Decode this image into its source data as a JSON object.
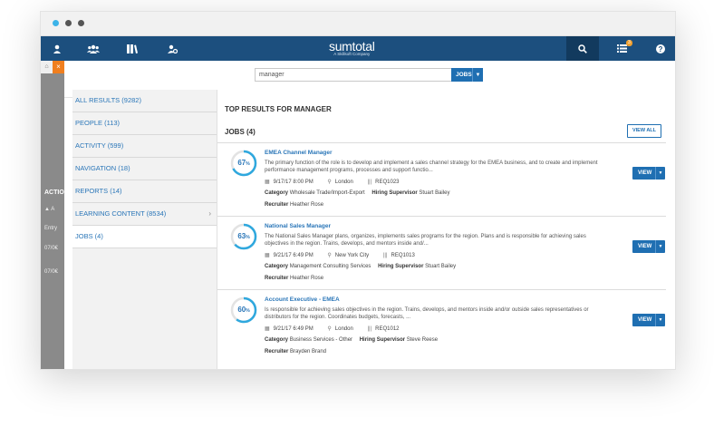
{
  "colors": {
    "navbar": "#1c4f7e",
    "accent": "#2a76b8",
    "button": "#1f6fb2",
    "close": "#f07f1f",
    "badge": "#f0a030"
  },
  "window": {
    "dots": [
      "#3cb3e8",
      "#555555",
      "#555555"
    ]
  },
  "navbar": {
    "icons": [
      "user-icon",
      "users-icon",
      "books-icon",
      "user-settings-icon"
    ],
    "logo_name": "sumtotal",
    "logo_sub": "A Skillsoft Company",
    "notifications_count": "3"
  },
  "left_rail": {
    "texts": [
      "ACTIO",
      "▲ A",
      "Entry",
      "07/0€",
      "07/0€"
    ]
  },
  "search": {
    "value": "manager",
    "scope": "JOBS"
  },
  "sidebar": {
    "items": [
      {
        "label": "ALL RESULTS (9282)"
      },
      {
        "label": "PEOPLE (113)"
      },
      {
        "label": "ACTIVITY (599)"
      },
      {
        "label": "NAVIGATION (18)"
      },
      {
        "label": "REPORTS (14)"
      },
      {
        "label": "LEARNING CONTENT (8534)",
        "chevron": "›"
      },
      {
        "label": "JOBS (4)"
      }
    ]
  },
  "main": {
    "title": "TOP RESULTS FOR MANAGER",
    "section": "JOBS (4)",
    "view_all": "VIEW ALL"
  },
  "labels": {
    "category": "Category",
    "hiring_supervisor": "Hiring Supervisor",
    "recruiter": "Recruiter",
    "view": "VIEW",
    "percent_sign": "%"
  },
  "jobs": [
    {
      "title": "EMEA Channel Manager",
      "match": 67,
      "match_text": "67",
      "description": "The primary function of the role is to develop and implement a sales channel strategy for the EMEA business, and to create and implement performance management programs, processes and support functio...",
      "date": "9/17/17 8:00 PM",
      "location": "London",
      "req": "REQ1023",
      "category": "Wholesale Trade/Import-Export",
      "supervisor": "Stuart Bailey",
      "recruiter": "Heather Rose"
    },
    {
      "title": "National Sales Manager",
      "match": 63,
      "match_text": "63",
      "description": "The National Sales Manager plans, organizes, implements sales programs for the region. Plans and is responsible for achieving sales objectives in the region. Trains, develops, and mentors inside and/...",
      "date": "9/21/17 6:49 PM",
      "location": "New York City",
      "req": "REQ1013",
      "category": "Management Consulting Services",
      "supervisor": "Stuart Bailey",
      "recruiter": "Heather Rose"
    },
    {
      "title": "Account Executive - EMEA",
      "match": 60,
      "match_text": "60",
      "description": "Is responsible for achieving sales objectives in the region. Trains, develops, and mentors inside and/or outside sales representatives or distributors for the region. Coordinates budgets, forecasts, ...",
      "date": "9/21/17 6:49 PM",
      "location": "London",
      "req": "REQ1012",
      "category": "Business Services - Other",
      "supervisor": "Steve Reese",
      "recruiter": "Brayden Brand"
    }
  ]
}
